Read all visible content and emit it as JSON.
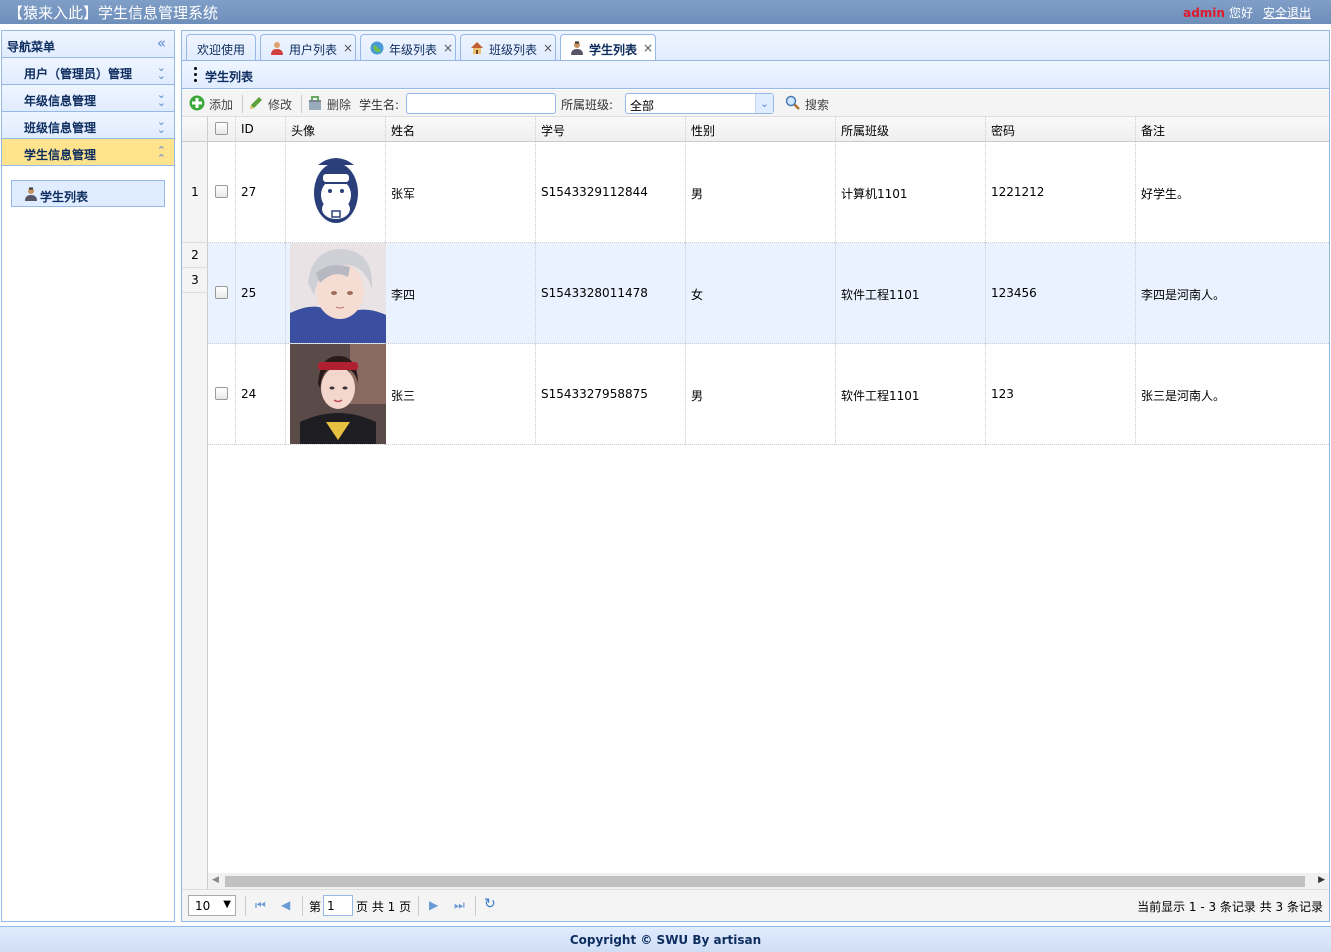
{
  "header": {
    "title": "【猿来入此】学生信息管理系统",
    "username": "admin",
    "greeting": "您好",
    "logout": "安全退出"
  },
  "sidebar": {
    "title": "导航菜单",
    "menus": [
      {
        "label": "用户（管理员）管理"
      },
      {
        "label": "年级信息管理"
      },
      {
        "label": "班级信息管理"
      },
      {
        "label": "学生信息管理"
      }
    ],
    "sub_item": "学生列表"
  },
  "tabs": [
    {
      "label": "欢迎使用"
    },
    {
      "label": "用户列表"
    },
    {
      "label": "年级列表"
    },
    {
      "label": "班级列表"
    },
    {
      "label": "学生列表"
    }
  ],
  "panel": {
    "title": "学生列表"
  },
  "toolbar": {
    "add": "添加",
    "edit": "修改",
    "delete": "删除",
    "name_label": "学生名:",
    "name_value": "",
    "class_label": "所属班级:",
    "class_value": "全部",
    "search": "搜索"
  },
  "table": {
    "columns": [
      "ID",
      "头像",
      "姓名",
      "学号",
      "性别",
      "所属班级",
      "密码",
      "备注"
    ],
    "rownumbers": [
      "1",
      "2",
      "3"
    ],
    "rows": [
      {
        "id": "27",
        "name": "张军",
        "sn": "S1543329112844",
        "sex": "男",
        "clazz": "计算机1101",
        "password": "1221212",
        "remark": "好学生。"
      },
      {
        "id": "25",
        "name": "李四",
        "sn": "S1543328011478",
        "sex": "女",
        "clazz": "软件工程1101",
        "password": "123456",
        "remark": "李四是河南人。"
      },
      {
        "id": "24",
        "name": "张三",
        "sn": "S1543327958875",
        "sex": "男",
        "clazz": "软件工程1101",
        "password": "123",
        "remark": "张三是河南人。"
      }
    ]
  },
  "pager": {
    "page_size": "10",
    "page_prefix": "第",
    "page_value": "1",
    "page_suffix": "页 共 1 页",
    "info": "当前显示 1 - 3 条记录 共 3 条记录"
  },
  "footer": {
    "text": "Copyright © SWU By artisan"
  },
  "colors": {
    "accent": "#95b8e7",
    "header_bg": "#7f9fc8",
    "active_menu": "#ffe48d",
    "username": "#e01a2a"
  }
}
